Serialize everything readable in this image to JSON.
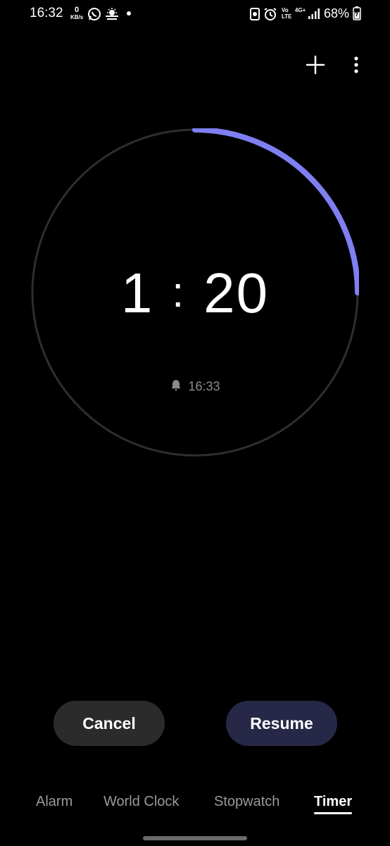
{
  "status_bar": {
    "time": "16:32",
    "data_speed_value": "0",
    "data_speed_unit": "KB/s",
    "network_volte": "Vo LTE",
    "network_type": "4G+",
    "battery": "68%"
  },
  "timer": {
    "minutes": "1",
    "separator": ":",
    "seconds": "20",
    "end_time": "16:33",
    "progress_remaining": 0.25,
    "accent_color": "#7f7ff2"
  },
  "actions": {
    "cancel": "Cancel",
    "resume": "Resume"
  },
  "tabs": [
    {
      "label": "Alarm"
    },
    {
      "label": "World Clock"
    },
    {
      "label": "Stopwatch"
    },
    {
      "label": "Timer",
      "active": true
    }
  ],
  "icons": {
    "add": "plus-icon",
    "more": "more-vertical-icon",
    "bell": "bell-icon"
  }
}
